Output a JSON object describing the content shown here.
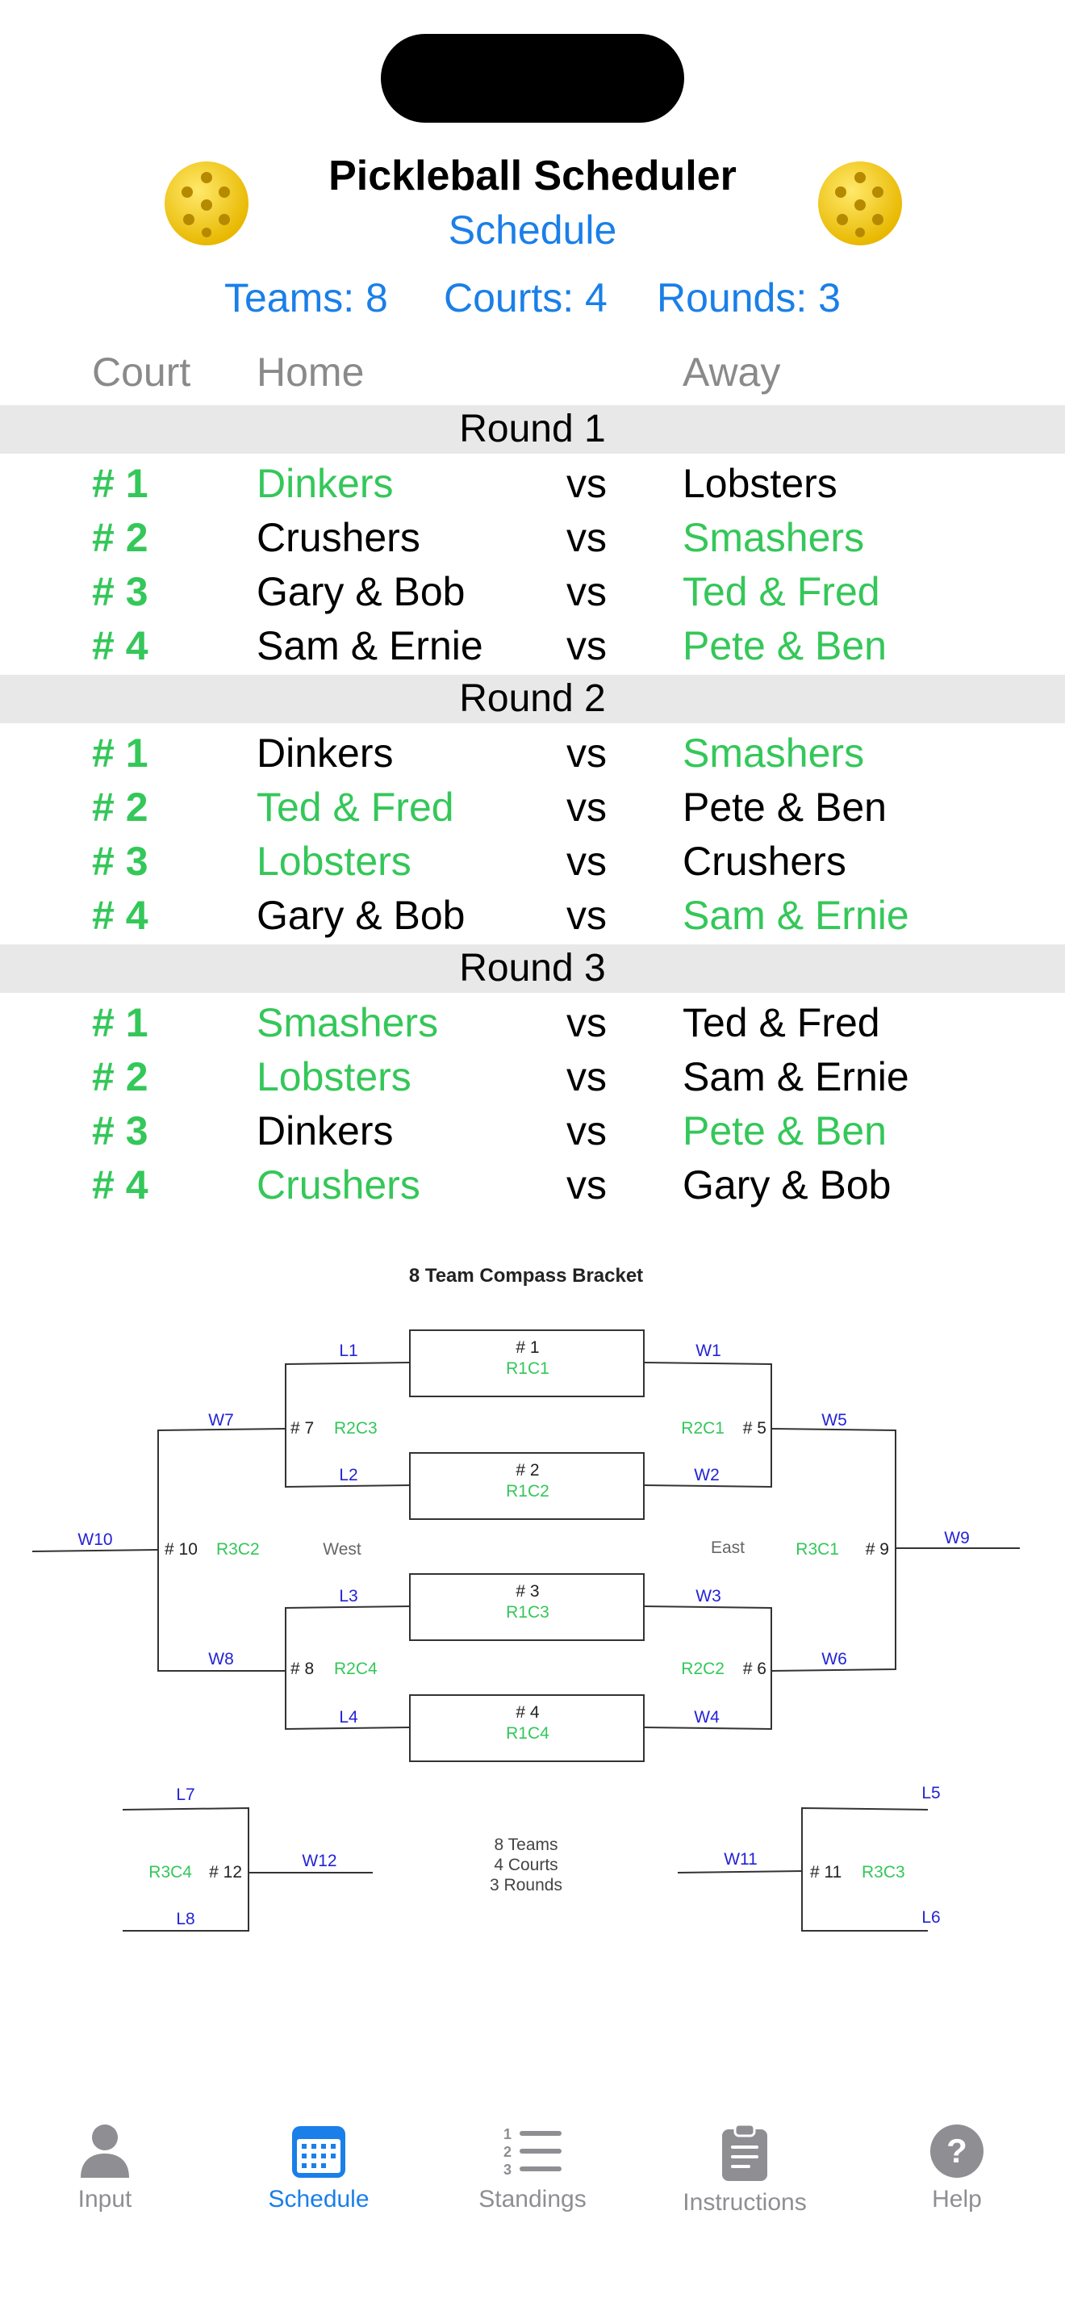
{
  "header": {
    "title": "Pickleball Scheduler",
    "subtitle": "Schedule",
    "teams": "Teams: 8",
    "courts": "Courts: 4",
    "rounds": "Rounds: 3"
  },
  "columns": {
    "court": "Court",
    "home": "Home",
    "away": "Away"
  },
  "schedule": {
    "vs": "vs",
    "rounds": [
      {
        "label": "Round 1",
        "matches": [
          {
            "court": "# 1",
            "home": "Dinkers",
            "away": "Lobsters",
            "winner": "home"
          },
          {
            "court": "# 2",
            "home": "Crushers",
            "away": "Smashers",
            "winner": "away"
          },
          {
            "court": "# 3",
            "home": "Gary & Bob",
            "away": "Ted & Fred",
            "winner": "away"
          },
          {
            "court": "# 4",
            "home": "Sam & Ernie",
            "away": "Pete & Ben",
            "winner": "away"
          }
        ]
      },
      {
        "label": "Round 2",
        "matches": [
          {
            "court": "# 1",
            "home": "Dinkers",
            "away": "Smashers",
            "winner": "away"
          },
          {
            "court": "# 2",
            "home": "Ted & Fred",
            "away": "Pete & Ben",
            "winner": "home"
          },
          {
            "court": "# 3",
            "home": "Lobsters",
            "away": "Crushers",
            "winner": "home"
          },
          {
            "court": "# 4",
            "home": "Gary & Bob",
            "away": "Sam & Ernie",
            "winner": "away"
          }
        ]
      },
      {
        "label": "Round 3",
        "matches": [
          {
            "court": "# 1",
            "home": "Smashers",
            "away": "Ted & Fred",
            "winner": "home"
          },
          {
            "court": "# 2",
            "home": "Lobsters",
            "away": "Sam & Ernie",
            "winner": "home"
          },
          {
            "court": "# 3",
            "home": "Dinkers",
            "away": "Pete & Ben",
            "winner": "away"
          },
          {
            "court": "# 4",
            "home": "Crushers",
            "away": "Gary & Bob",
            "winner": "home"
          }
        ]
      }
    ]
  },
  "bracket": {
    "title": "8 Team Compass Bracket",
    "west": "West",
    "east": "East",
    "summary": [
      "8 Teams",
      "4 Courts",
      "3 Rounds"
    ],
    "games": [
      {
        "num": "# 1",
        "code": "R1C1"
      },
      {
        "num": "# 2",
        "code": "R1C2"
      },
      {
        "num": "# 3",
        "code": "R1C3"
      },
      {
        "num": "# 4",
        "code": "R1C4"
      },
      {
        "num": "# 5",
        "code": "R2C1"
      },
      {
        "num": "# 6",
        "code": "R2C2"
      },
      {
        "num": "# 7",
        "code": "R2C3"
      },
      {
        "num": "# 8",
        "code": "R2C4"
      },
      {
        "num": "# 9",
        "code": "R3C1"
      },
      {
        "num": "# 10",
        "code": "R3C2"
      },
      {
        "num": "# 11",
        "code": "R3C3"
      },
      {
        "num": "# 12",
        "code": "R3C4"
      }
    ],
    "links": [
      "L1",
      "L2",
      "L3",
      "L4",
      "L5",
      "L6",
      "L7",
      "L8",
      "W1",
      "W2",
      "W3",
      "W4",
      "W5",
      "W6",
      "W7",
      "W8",
      "W9",
      "W10",
      "W11",
      "W12"
    ]
  },
  "tabbar": {
    "active": "schedule",
    "tabs": [
      {
        "key": "input",
        "label": "Input",
        "icon": "person-icon"
      },
      {
        "key": "schedule",
        "label": "Schedule",
        "icon": "calendar-icon"
      },
      {
        "key": "standings",
        "label": "Standings",
        "icon": "numbered-list-icon"
      },
      {
        "key": "instructions",
        "label": "Instructions",
        "icon": "clipboard-icon"
      },
      {
        "key": "help",
        "label": "Help",
        "icon": "question-mark-icon"
      }
    ]
  },
  "colors": {
    "accent": "#1a7fe8",
    "winner": "#34c759",
    "bracket_link": "#2323d6",
    "round_bar": "#e8e8e8"
  }
}
